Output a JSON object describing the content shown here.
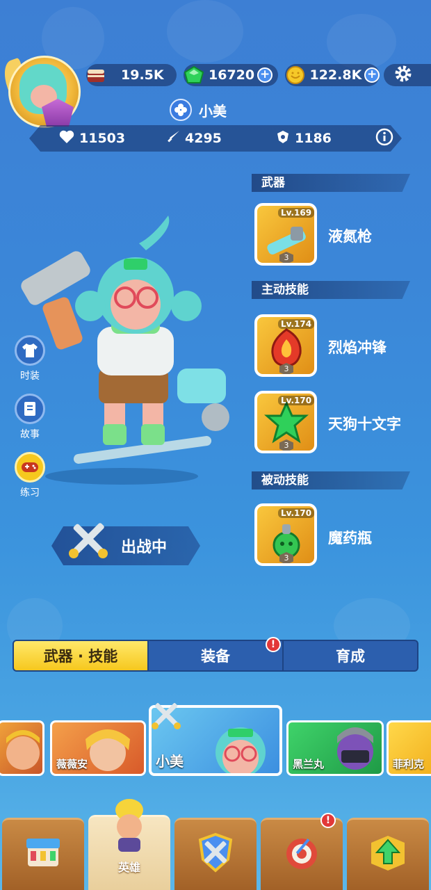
{
  "resources": {
    "cake": "19.5K",
    "gems": "16720",
    "coins": "122.8K"
  },
  "hero": {
    "name": "小美"
  },
  "stats": {
    "hp": "11503",
    "attack": "4295",
    "defense": "1186"
  },
  "sections": {
    "weapon": "武器",
    "active": "主动技能",
    "passive": "被动技能"
  },
  "skills": [
    {
      "level": "Lv.169",
      "name": "液氮枪",
      "stars": "3"
    },
    {
      "level": "Lv.174",
      "name": "烈焰冲锋",
      "stars": "3"
    },
    {
      "level": "Lv.170",
      "name": "天狗十文字",
      "stars": "3"
    },
    {
      "level": "Lv.170",
      "name": "魔药瓶",
      "stars": "3"
    }
  ],
  "side_buttons": {
    "costume": "时装",
    "story": "故事",
    "practice": "练习"
  },
  "deploy_label": "出战中",
  "tabs": {
    "weapon_skill": "武器 · 技能",
    "equipment": "装备",
    "training": "育成"
  },
  "alert_mark": "!",
  "hero_list": [
    "薇薇安",
    "小美",
    "黑兰丸",
    "菲利克"
  ],
  "nav": {
    "heroes": "英雄"
  }
}
